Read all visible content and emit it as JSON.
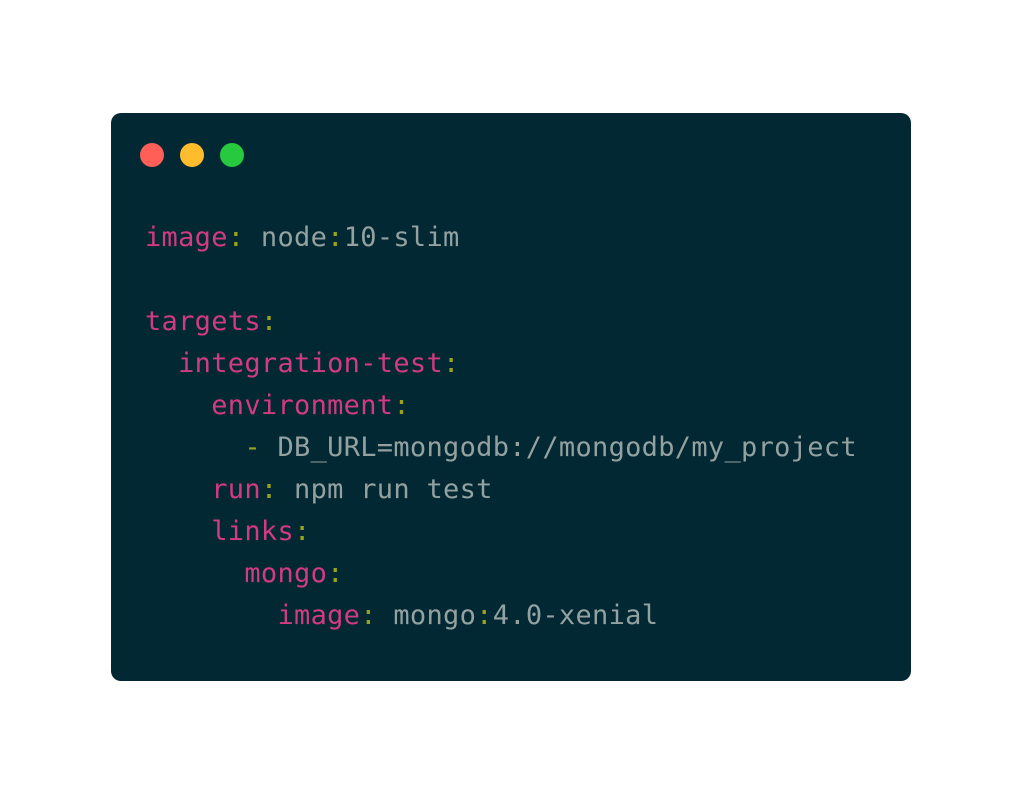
{
  "window": {
    "controls": {
      "close_color": "#ff5f56",
      "minimize_color": "#ffbd2e",
      "maximize_color": "#27c93f"
    }
  },
  "colors": {
    "background": "#022833",
    "key": "#d23a82",
    "punctuation": "#9aa31a",
    "value": "#93a1a1"
  },
  "code": {
    "lines": [
      {
        "indent": "",
        "key": "image",
        "sep": ": ",
        "value": "node",
        "colon2": ":",
        "value2": "10-slim"
      },
      {
        "blank": true
      },
      {
        "indent": "",
        "key": "targets",
        "sep": ":"
      },
      {
        "indent": "  ",
        "key": "integration-test",
        "sep": ":"
      },
      {
        "indent": "    ",
        "key": "environment",
        "sep": ":"
      },
      {
        "indent": "      ",
        "dash": "- ",
        "value": "DB_URL=mongodb://mongodb/my_project"
      },
      {
        "indent": "    ",
        "key": "run",
        "sep": ": ",
        "value": "npm run test"
      },
      {
        "indent": "    ",
        "key": "links",
        "sep": ":"
      },
      {
        "indent": "      ",
        "key": "mongo",
        "sep": ":"
      },
      {
        "indent": "        ",
        "key": "image",
        "sep": ": ",
        "value": "mongo",
        "colon2": ":",
        "value2": "4.0-xenial"
      }
    ]
  }
}
